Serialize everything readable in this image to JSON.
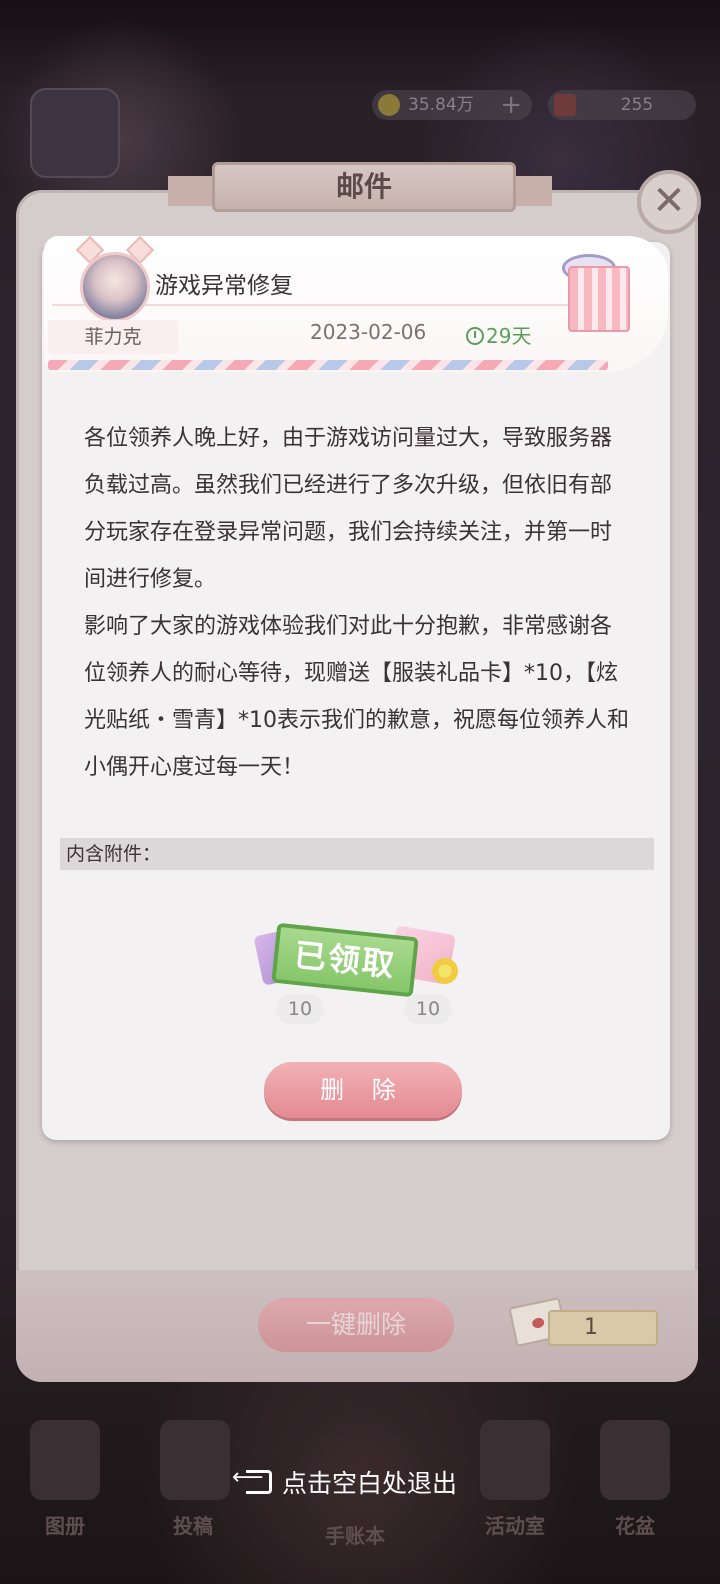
{
  "status_bar": {
    "coins": "35.84万",
    "gems": "255"
  },
  "dialog": {
    "title": "邮件",
    "close_icon": "close-x",
    "bulk_delete_label": "一键删除",
    "mail_count": "1"
  },
  "mail": {
    "subject": "游戏异常修复",
    "sender": "菲力克",
    "date": "2023-02-06",
    "expires": "29天",
    "body": [
      "各位领养人晚上好，由于游戏访问量过大，导致服务器负载过高。虽然我们已经进行了多次升级，但依旧有部分玩家存在登录异常问题，我们会持续关注，并第一时间进行修复。",
      "影响了大家的游戏体验我们对此十分抱歉，非常感谢各位领养人的耐心等待，现赠送【服装礼品卡】*10，【炫光贴纸・雪青】*10表示我们的歉意，祝愿每位领养人和小偶开心度过每一天！"
    ],
    "attachments_label": "内含附件：",
    "attachments": [
      {
        "count": "10",
        "icon": "gift-card-icon"
      },
      {
        "count": "10",
        "icon": "diy-sticker-icon"
      }
    ],
    "claimed_stamp": "已领取",
    "delete_label": "删 除"
  },
  "bottom_nav": [
    {
      "label": "图册"
    },
    {
      "label": "投稿"
    },
    {
      "label": "手账本"
    },
    {
      "label": "活动室"
    },
    {
      "label": "花盆"
    }
  ],
  "exit_hint": "点击空白处退出"
}
